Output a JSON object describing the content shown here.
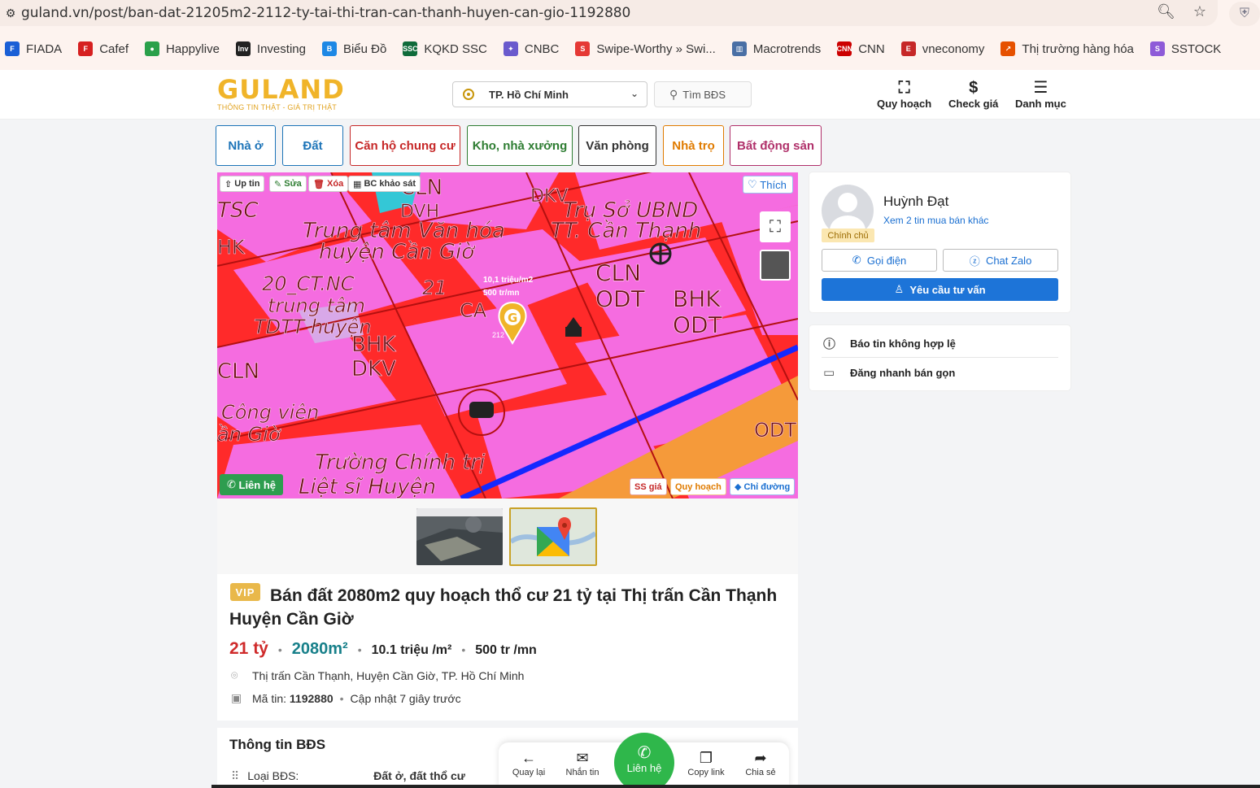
{
  "browser": {
    "url": "guland.vn/post/ban-dat-21205m2-2112-ty-tai-thi-tran-can-thanh-huyen-can-gio-1192880",
    "bookmarks": [
      {
        "label": "FIADA",
        "color": "#1a5fd6",
        "icon": "F"
      },
      {
        "label": "Cafef",
        "color": "#d62020",
        "icon": "F"
      },
      {
        "label": "Happylive",
        "color": "#2aa04a",
        "icon": "●"
      },
      {
        "label": "Investing",
        "color": "#222222",
        "icon": "Inv"
      },
      {
        "label": "Biểu Đồ",
        "color": "#1e88e5",
        "icon": "B"
      },
      {
        "label": "KQKD SSC",
        "color": "#0f6b3a",
        "icon": "SSC"
      },
      {
        "label": "CNBC",
        "color": "#6a5acd",
        "icon": "✦"
      },
      {
        "label": "Swipe-Worthy » Swi...",
        "color": "#e53935",
        "icon": "S"
      },
      {
        "label": "Macrotrends",
        "color": "#4a6fa5",
        "icon": "▥"
      },
      {
        "label": "CNN",
        "color": "#cc0000",
        "icon": "CNN"
      },
      {
        "label": "vneconomy",
        "color": "#c62828",
        "icon": "E"
      },
      {
        "label": "Thị trường hàng hóa",
        "color": "#e65100",
        "icon": "↗"
      },
      {
        "label": "SSTOCK",
        "color": "#8e5bd8",
        "icon": "S"
      }
    ]
  },
  "header": {
    "logo_main": "GULAND",
    "logo_sub": "THÔNG TIN THẬT - GIÁ TRỊ THẬT",
    "city": "TP. Hồ Chí Minh",
    "search_label": "Tìm BĐS",
    "btn_planning": "Quy hoạch",
    "btn_check_price": "Check giá",
    "btn_menu": "Danh mục"
  },
  "categories": [
    {
      "label": "Nhà ở",
      "color": "#1d74b8"
    },
    {
      "label": "Đất",
      "color": "#1d74b8"
    },
    {
      "label": "Căn hộ chung cư",
      "color": "#c62828"
    },
    {
      "label": "Kho, nhà xưởng",
      "color": "#2e7d32"
    },
    {
      "label": "Văn phòng",
      "color": "#333333"
    },
    {
      "label": "Nhà trọ",
      "color": "#e07b00"
    },
    {
      "label": "Bất động sản",
      "color": "#b0306a"
    }
  ],
  "map": {
    "tag_up": "Up tin",
    "tag_edit": "Sửa",
    "tag_delete": "Xóa",
    "tag_report": "BC khảo sát",
    "like": "Thích",
    "marker_price": "10,1 triệu/m2",
    "marker_rent": "500 tr/mn",
    "marker_num": "212",
    "contact": "Liên hệ",
    "btn_compare": "SS giá",
    "btn_planning": "Quy hoạch",
    "btn_direction": "Chỉ đường",
    "labels": [
      "TSC",
      "Trung tâm Văn hóa",
      "huyện Cần Giờ",
      "Trụ Sở UBND",
      "TT. Cần Thạnh",
      "CLN",
      "ODT",
      "BHK",
      "ODT",
      "20_CT.NC",
      "trung tâm",
      "TDTT huyện",
      "CA",
      "21",
      "BHK",
      "DKV",
      "CLN",
      "Công viên",
      "ần Giờ",
      "Trường Chính trị",
      "Liệt sĩ Huyện",
      "ODT",
      "CLN",
      "DVH",
      "HK",
      "DKV"
    ]
  },
  "listing": {
    "vip": "VIP",
    "title": "Bán đất 2080m2 quy hoạch thổ cư 21 tỷ tại Thị trấn Cần Thạnh Huyện Cần Giờ",
    "price": "21 tỷ",
    "area": "2080m²",
    "price_per_m2": "10.1 triệu /m²",
    "rent": "500 tr /mn",
    "address": "Thị trấn Cần Thạnh, Huyện Cần Giờ, TP. Hồ Chí Minh",
    "code_label": "Mã tin:",
    "code": "1192880",
    "updated": "Cập nhật 7 giây trước"
  },
  "info": {
    "title": "Thông tin BĐS",
    "row_label": "Loại BĐS:",
    "row_value": "Đất ở, đất thổ cư"
  },
  "seller": {
    "name": "Huỳnh Đạt",
    "more": "Xem 2 tin mua bán khác",
    "badge": "Chính chủ",
    "call": "Gọi điện",
    "zalo": "Chat Zalo",
    "consult": "Yêu cầu tư vấn"
  },
  "side_actions": {
    "report": "Báo tin không hợp lệ",
    "quick_sell": "Đăng nhanh bán gọn"
  },
  "bottom_bar": {
    "back": "Quay lại",
    "message": "Nhắn tin",
    "contact": "Liên hệ",
    "copy": "Copy link",
    "share": "Chia sẻ"
  }
}
